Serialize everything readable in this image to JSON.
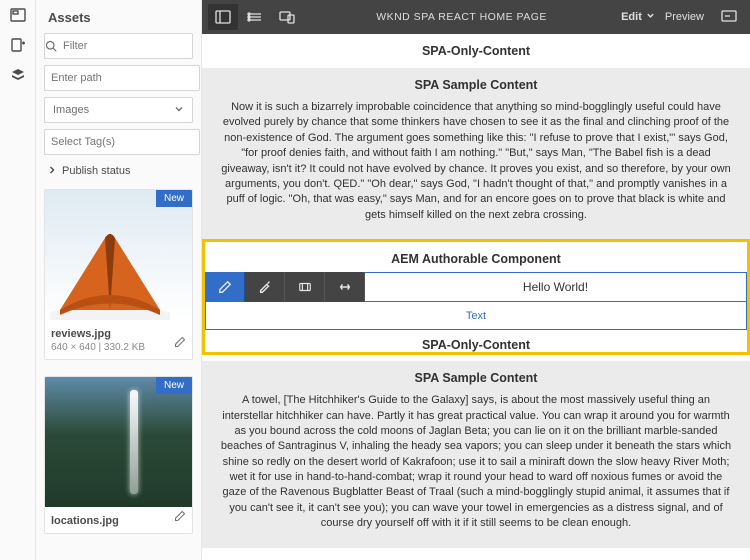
{
  "leftbar": {
    "icons": [
      "panel-icon",
      "add-page-icon",
      "layers-icon"
    ]
  },
  "assets": {
    "title": "Assets",
    "filter_placeholder": "Filter",
    "path_placeholder": "Enter path",
    "type_selected": "Images",
    "tags_placeholder": "Select Tag(s)",
    "publish_label": "Publish status",
    "cards": [
      {
        "badge": "New",
        "filename": "reviews.jpg",
        "meta": "640 × 640 | 330.2 KB",
        "img": "tent"
      },
      {
        "badge": "New",
        "filename": "locations.jpg",
        "meta": "",
        "img": "waterfall"
      }
    ]
  },
  "toolbar": {
    "title": "WKND SPA REACT HOME PAGE",
    "mode": "Edit",
    "preview": "Preview"
  },
  "content": {
    "spa_only_title": "SPA-Only-Content",
    "sample1_title": "SPA Sample Content",
    "sample1_body": "Now it is such a bizarrely improbable coincidence that anything so mind-bogglingly useful could have evolved purely by chance that some thinkers have chosen to see it as the final and clinching proof of the non-existence of God. The argument goes something like this: \"I refuse to prove that I exist,\"' says God, \"for proof denies faith, and without faith I am nothing.\" \"But,\" says Man, \"The Babel fish is a dead giveaway, isn't it? It could not have evolved by chance. It proves you exist, and so therefore, by your own arguments, you don't. QED.\" \"Oh dear,\" says God, \"I hadn't thought of that,\" and promptly vanishes in a puff of logic. \"Oh, that was easy,\" says Man, and for an encore goes on to prove that black is white and gets himself killed on the next zebra crossing.",
    "authorable_title": "AEM Authorable Component",
    "hello": "Hello World!",
    "text_drop": "Text",
    "spa_only_title_2": "SPA-Only-Content",
    "sample2_title": "SPA Sample Content",
    "sample2_body": "A towel, [The Hitchhiker's Guide to the Galaxy] says, is about the most massively useful thing an interstellar hitchhiker can have. Partly it has great practical value. You can wrap it around you for warmth as you bound across the cold moons of Jaglan Beta; you can lie on it on the brilliant marble-sanded beaches of Santraginus V, inhaling the heady sea vapors; you can sleep under it beneath the stars which shine so redly on the desert world of Kakrafoon; use it to sail a miniraft down the slow heavy River Moth; wet it for use in hand-to-hand-combat; wrap it round your head to ward off noxious fumes or avoid the gaze of the Ravenous Bugblatter Beast of Traal (such a mind-bogglingly stupid animal, it assumes that if you can't see it, it can't see you); you can wave your towel in emergencies as a distress signal, and of course dry yourself off with it if it still seems to be clean enough."
  }
}
